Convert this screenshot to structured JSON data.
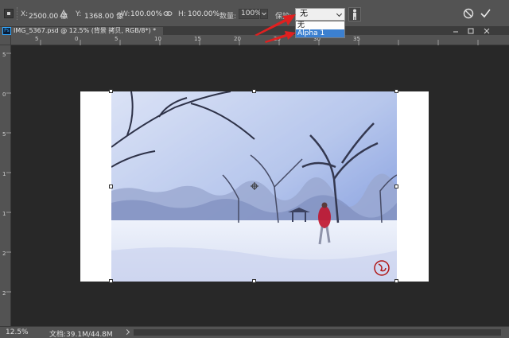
{
  "options_bar": {
    "x_label": "X:",
    "x_value": "2500.00 像",
    "y_label": "Y:",
    "y_value": "1368.00 像",
    "w_label": "W:",
    "w_value": "100.00%",
    "h_label": "H:",
    "h_value": "100.00%",
    "amount_label": "数量:",
    "amount_value": "100%",
    "protect_label": "保护:",
    "protect_value": "无"
  },
  "protect_dropdown": {
    "options": [
      "无",
      "Alpha 1"
    ],
    "highlighted": "Alpha 1"
  },
  "document_tab": {
    "badge": "Ps",
    "title": "IMG_5367.psd @ 12.5% (背景 拷贝, RGB/8*) *"
  },
  "ruler_top": {
    "labels": [
      "5",
      "0",
      "5",
      "10",
      "15",
      "20",
      "25",
      "30",
      "35"
    ]
  },
  "ruler_left": {
    "labels": [
      "5",
      "0",
      "5",
      "1",
      "1",
      "2",
      "2"
    ]
  },
  "status_bar": {
    "zoom": "12.5%",
    "doc_info": "文档:39.1M/44.8M"
  },
  "colors": {
    "accent_arrow": "#e02020",
    "selection_blue": "#3c80d0",
    "panel_bg": "#535353",
    "workspace_bg": "#282828"
  }
}
